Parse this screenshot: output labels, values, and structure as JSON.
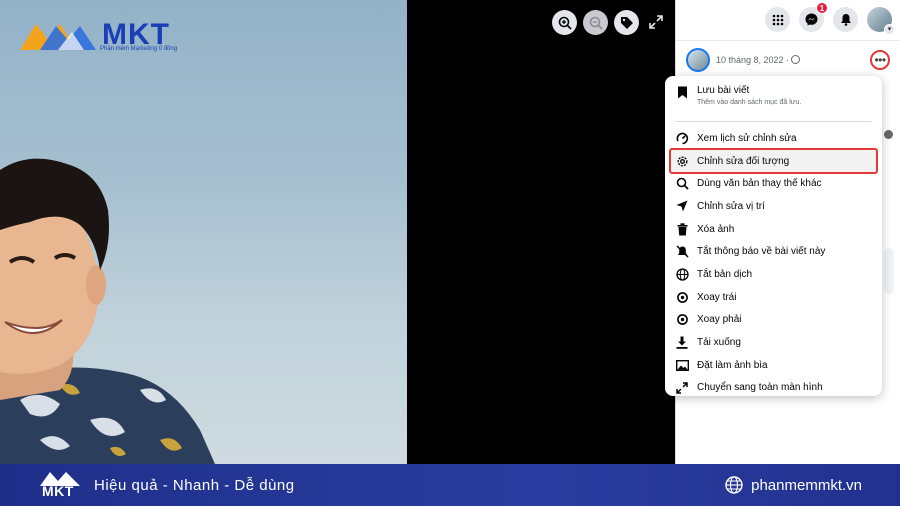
{
  "brand": {
    "logo_name": "MKT",
    "logo_tagline": "Phần mềm Marketing 0 đồng"
  },
  "top_bar": {
    "messenger_badge": "1"
  },
  "post": {
    "date": "10 tháng 8, 2022 ·"
  },
  "menu": {
    "items": [
      {
        "label": "Lưu bài viết",
        "sub": "Thêm vào danh sách mục đã lưu.",
        "icon": "bookmark-icon"
      },
      {
        "label": "Xem lịch sử chỉnh sửa",
        "icon": "history-icon"
      },
      {
        "label": "Chỉnh sửa đối tượng",
        "icon": "gear-icon"
      },
      {
        "label": "Dùng văn bản thay thế khác",
        "icon": "search-icon"
      },
      {
        "label": "Chỉnh sửa vị trí",
        "icon": "location-arrow-icon"
      },
      {
        "label": "Xóa ảnh",
        "icon": "trash-icon"
      },
      {
        "label": "Tắt thông báo về bài viết này",
        "icon": "bell-off-icon"
      },
      {
        "label": "Tắt bản dịch",
        "icon": "translate-icon"
      },
      {
        "label": "Xoay trái",
        "icon": "rotate-left-icon"
      },
      {
        "label": "Xoay phải",
        "icon": "rotate-right-icon"
      },
      {
        "label": "Tải xuống",
        "icon": "download-icon"
      },
      {
        "label": "Đặt làm ảnh bìa",
        "icon": "image-icon"
      },
      {
        "label": "Chuyển sang toàn màn hình",
        "icon": "expand-icon"
      }
    ]
  },
  "banner": {
    "logo_text": "MKT",
    "slogan": "Hiệu quả - Nhanh - Dễ dùng",
    "website": "phanmemmkt.vn"
  },
  "colors": {
    "highlight_border": "#e53935",
    "banner_bg": "#22318f",
    "facebook_blue": "#1877f2"
  }
}
